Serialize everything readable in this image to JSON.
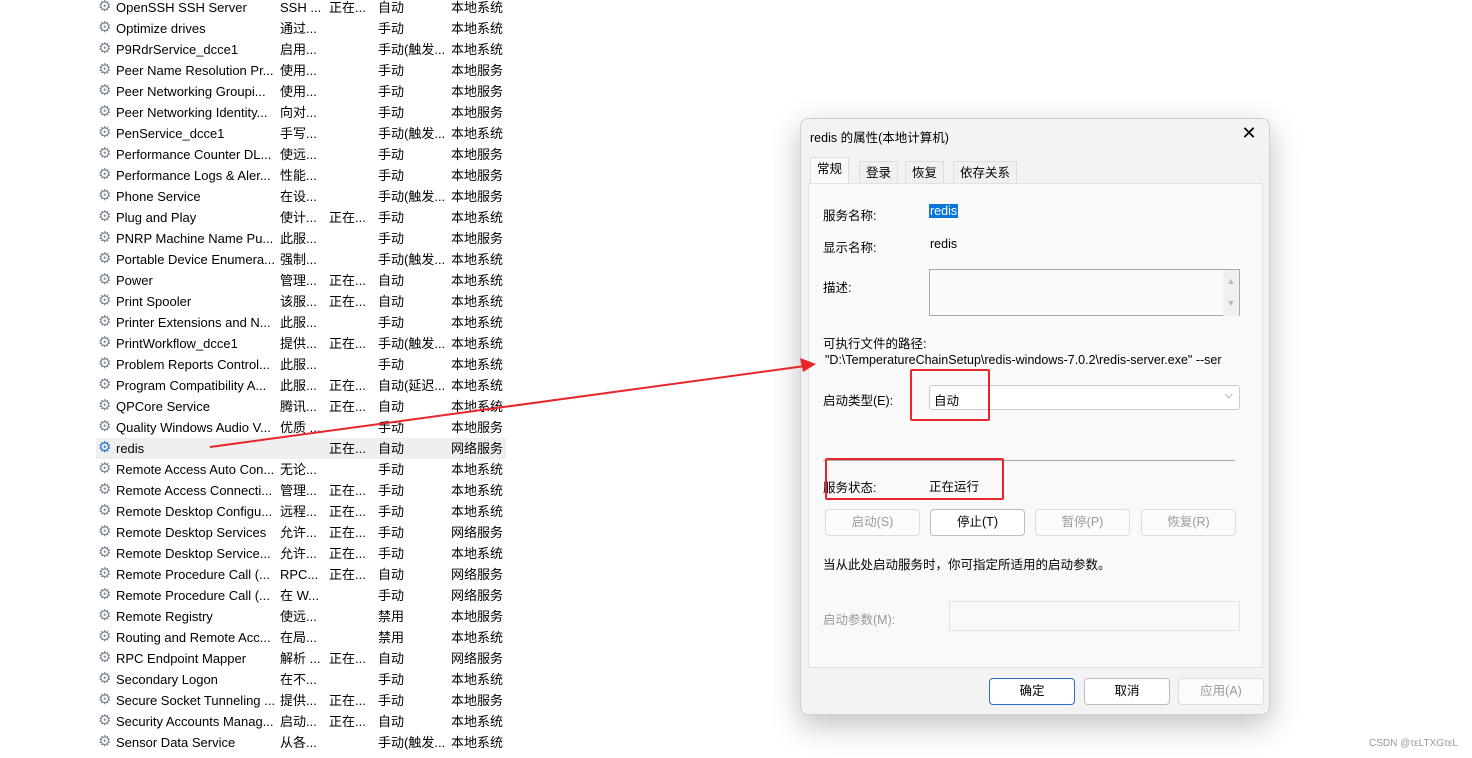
{
  "services": [
    [
      "OpenSSH SSH Server",
      "SSH ...",
      "正在...",
      "自动",
      "本地系统"
    ],
    [
      "Optimize drives",
      "通过...",
      "",
      "手动",
      "本地系统"
    ],
    [
      "P9RdrService_dcce1",
      "启用...",
      "",
      "手动(触发...",
      "本地系统"
    ],
    [
      "Peer Name Resolution Pr...",
      "使用...",
      "",
      "手动",
      "本地服务"
    ],
    [
      "Peer Networking Groupi...",
      "使用...",
      "",
      "手动",
      "本地服务"
    ],
    [
      "Peer Networking Identity...",
      "向对...",
      "",
      "手动",
      "本地服务"
    ],
    [
      "PenService_dcce1",
      "手写...",
      "",
      "手动(触发...",
      "本地系统"
    ],
    [
      "Performance Counter DL...",
      "使远...",
      "",
      "手动",
      "本地服务"
    ],
    [
      "Performance Logs & Aler...",
      "性能...",
      "",
      "手动",
      "本地服务"
    ],
    [
      "Phone Service",
      "在设...",
      "",
      "手动(触发...",
      "本地服务"
    ],
    [
      "Plug and Play",
      "使计...",
      "正在...",
      "手动",
      "本地系统"
    ],
    [
      "PNRP Machine Name Pu...",
      "此服...",
      "",
      "手动",
      "本地服务"
    ],
    [
      "Portable Device Enumera...",
      "强制...",
      "",
      "手动(触发...",
      "本地系统"
    ],
    [
      "Power",
      "管理...",
      "正在...",
      "自动",
      "本地系统"
    ],
    [
      "Print Spooler",
      "该服...",
      "正在...",
      "自动",
      "本地系统"
    ],
    [
      "Printer Extensions and N...",
      "此服...",
      "",
      "手动",
      "本地系统"
    ],
    [
      "PrintWorkflow_dcce1",
      "提供...",
      "正在...",
      "手动(触发...",
      "本地系统"
    ],
    [
      "Problem Reports Control...",
      "此服...",
      "",
      "手动",
      "本地系统"
    ],
    [
      "Program Compatibility A...",
      "此服...",
      "正在...",
      "自动(延迟...",
      "本地系统"
    ],
    [
      "QPCore Service",
      "腾讯...",
      "正在...",
      "自动",
      "本地系统"
    ],
    [
      "Quality Windows Audio V...",
      "优质 ...",
      "",
      "手动",
      "本地服务"
    ],
    [
      "redis",
      "",
      "正在...",
      "自动",
      "网络服务"
    ],
    [
      "Remote Access Auto Con...",
      "无论...",
      "",
      "手动",
      "本地系统"
    ],
    [
      "Remote Access Connecti...",
      "管理...",
      "正在...",
      "手动",
      "本地系统"
    ],
    [
      "Remote Desktop Configu...",
      "远程...",
      "正在...",
      "手动",
      "本地系统"
    ],
    [
      "Remote Desktop Services",
      "允许...",
      "正在...",
      "手动",
      "网络服务"
    ],
    [
      "Remote Desktop Service...",
      "允许...",
      "正在...",
      "手动",
      "本地系统"
    ],
    [
      "Remote Procedure Call (...",
      "RPC...",
      "正在...",
      "自动",
      "网络服务"
    ],
    [
      "Remote Procedure Call (...",
      "在 W...",
      "",
      "手动",
      "网络服务"
    ],
    [
      "Remote Registry",
      "使远...",
      "",
      "禁用",
      "本地服务"
    ],
    [
      "Routing and Remote Acc...",
      "在局...",
      "",
      "禁用",
      "本地系统"
    ],
    [
      "RPC Endpoint Mapper",
      "解析 ...",
      "正在...",
      "自动",
      "网络服务"
    ],
    [
      "Secondary Logon",
      "在不...",
      "",
      "手动",
      "本地系统"
    ],
    [
      "Secure Socket Tunneling ...",
      "提供...",
      "正在...",
      "手动",
      "本地服务"
    ],
    [
      "Security Accounts Manag...",
      "启动...",
      "正在...",
      "自动",
      "本地系统"
    ],
    [
      "Sensor Data Service",
      "从各...",
      "",
      "手动(触发...",
      "本地系统"
    ]
  ],
  "selected_index": 21,
  "dialog": {
    "title": "redis 的属性(本地计算机)",
    "tabs": [
      "常规",
      "登录",
      "恢复",
      "依存关系"
    ],
    "service_name_label": "服务名称:",
    "service_name": "redis",
    "display_name_label": "显示名称:",
    "display_name": "redis",
    "description_label": "描述:",
    "description": "",
    "path_label": "可执行文件的路径:",
    "path": "\"D:\\TemperatureChainSetup\\redis-windows-7.0.2\\redis-server.exe\" --ser",
    "startup_type_label": "启动类型(E):",
    "startup_type": "自动",
    "status_label": "服务状态:",
    "status": "正在运行",
    "start": "启动(S)",
    "stop": "停止(T)",
    "pause": "暂停(P)",
    "resume": "恢复(R)",
    "hint": "当从此处启动服务时，你可指定所适用的启动参数。",
    "params_label": "启动参数(M):",
    "params": "",
    "ok": "确定",
    "cancel": "取消",
    "apply": "应用(A)"
  },
  "annotation_color": "#e8262a",
  "watermark": "CSDN @τεLTXGτεL"
}
